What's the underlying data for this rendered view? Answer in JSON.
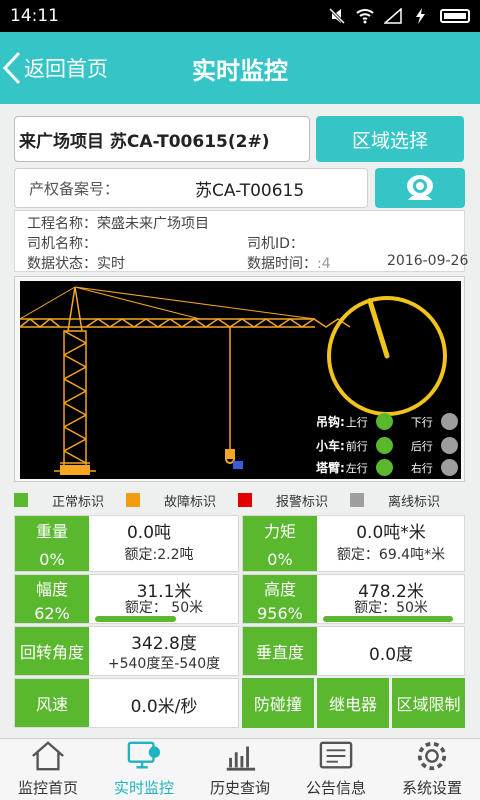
{
  "status_bar": {
    "time": "14:11"
  },
  "header": {
    "back_label": "返回首页",
    "title": "实时监控"
  },
  "project": {
    "name": "来广场项目  苏CA-T00615(2#)",
    "region_button": "区域选择"
  },
  "record": {
    "label": "产权备案号：",
    "value": "苏CA-T00615"
  },
  "info": {
    "project_label": "工程名称：",
    "project_value": "荣盛未来广场项目",
    "driver_name_label": "司机名称：",
    "driver_name_value": "",
    "driver_id_label": "司机ID：",
    "driver_id_value": "",
    "data_state_label": "数据状态：",
    "data_state_value": "实时",
    "data_time_label": "数据时间：",
    "data_time_value": "2016-09-26",
    "data_time_prefix": ":4"
  },
  "directions": {
    "hook": {
      "label": "吊钩:",
      "a": "上行",
      "b": "下行",
      "a_color": "#5ab82e",
      "b_color": "#9e9e9e"
    },
    "trolley": {
      "label": "小车:",
      "a": "前行",
      "b": "后行",
      "a_color": "#5ab82e",
      "b_color": "#9e9e9e"
    },
    "boom": {
      "label": "塔臂:",
      "a": "左行",
      "b": "右行",
      "a_color": "#5ab82e",
      "b_color": "#9e9e9e"
    }
  },
  "dial": {
    "angle_deg": 342.8,
    "ring_color": "#f0c419"
  },
  "legend": [
    {
      "label": "正常标识",
      "color": "#5ab82e"
    },
    {
      "label": "故障标识",
      "color": "#f39c12"
    },
    {
      "label": "报警标识",
      "color": "#e00000"
    },
    {
      "label": "离线标识",
      "color": "#9e9e9e"
    }
  ],
  "tiles": {
    "weight": {
      "name": "重量",
      "pct": "0%",
      "value": "0.0吨",
      "rated": "额定:2.2吨"
    },
    "torque": {
      "name": "力矩",
      "pct": "0%",
      "value": "0.0吨*米",
      "rated": "额定：69.4吨*米"
    },
    "amplitude": {
      "name": "幅度",
      "pct": "62%",
      "value": "31.1米",
      "rated": "额定： 50米",
      "fill": 0.62
    },
    "height": {
      "name": "高度",
      "pct": "956%",
      "value": "478.2米",
      "rated": "额定：50米",
      "fill": 1.0
    },
    "rotation": {
      "name": "回转角度",
      "value": "342.8度",
      "range": "+540度至-540度"
    },
    "vertical": {
      "name": "垂直度",
      "value": "0.0度"
    },
    "wind": {
      "name": "风速",
      "value": "0.0米/秒"
    },
    "buttons": [
      "防碰撞",
      "继电器",
      "区域限制"
    ]
  },
  "nav": [
    {
      "label": "监控首页",
      "icon": "home-icon"
    },
    {
      "label": "实时监控",
      "icon": "monitor-icon"
    },
    {
      "label": "历史查询",
      "icon": "chart-icon"
    },
    {
      "label": "公告信息",
      "icon": "notice-icon"
    },
    {
      "label": "系统设置",
      "icon": "gear-icon"
    }
  ]
}
